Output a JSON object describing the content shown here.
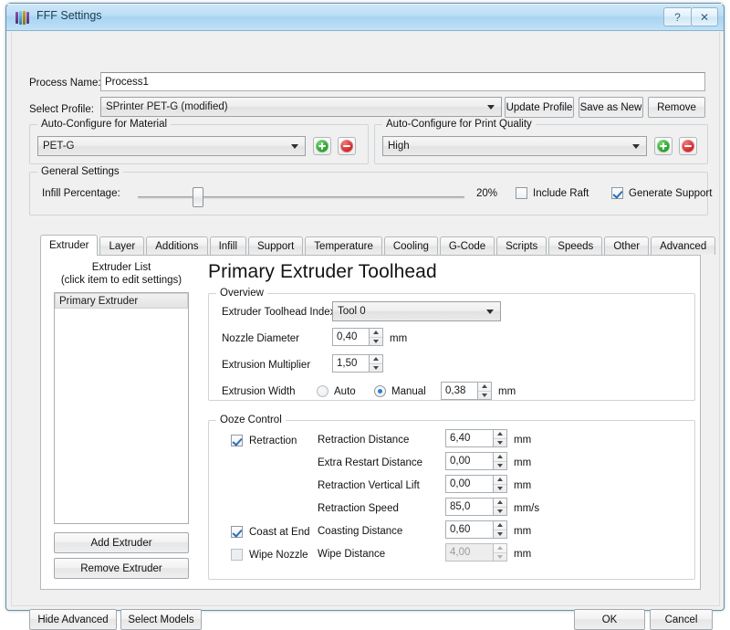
{
  "window": {
    "title": "FFF Settings",
    "icon": "extruder-bars-icon",
    "help_label": "?",
    "close_label": "✕"
  },
  "header": {
    "process_name_label": "Process Name:",
    "process_name_value": "Process1",
    "select_profile_label": "Select Profile:",
    "select_profile_value": "SPrinter PET-G (modified)",
    "update_profile_label": "Update Profile",
    "save_as_new_label": "Save as New",
    "remove_label": "Remove"
  },
  "material_group": {
    "title": "Auto-Configure for Material",
    "value": "PET-G",
    "add_label": "+",
    "remove_label": "−"
  },
  "quality_group": {
    "title": "Auto-Configure for Print Quality",
    "value": "High",
    "add_label": "+",
    "remove_label": "−"
  },
  "general_group": {
    "title": "General Settings",
    "infill_label": "Infill Percentage:",
    "infill_value": "20%",
    "infill_percent": 20,
    "include_raft_label": "Include Raft",
    "include_raft_checked": false,
    "generate_support_label": "Generate Support",
    "generate_support_checked": true
  },
  "tabs": [
    {
      "label": "Extruder",
      "active": true
    },
    {
      "label": "Layer",
      "active": false
    },
    {
      "label": "Additions",
      "active": false
    },
    {
      "label": "Infill",
      "active": false
    },
    {
      "label": "Support",
      "active": false
    },
    {
      "label": "Temperature",
      "active": false
    },
    {
      "label": "Cooling",
      "active": false
    },
    {
      "label": "G-Code",
      "active": false
    },
    {
      "label": "Scripts",
      "active": false
    },
    {
      "label": "Speeds",
      "active": false
    },
    {
      "label": "Other",
      "active": false
    },
    {
      "label": "Advanced",
      "active": false
    }
  ],
  "extruder_panel": {
    "list_title_line1": "Extruder List",
    "list_title_line2": "(click item to edit settings)",
    "items": [
      "Primary Extruder"
    ],
    "add_extruder_label": "Add Extruder",
    "remove_extruder_label": "Remove Extruder",
    "panel_title": "Primary Extruder Toolhead",
    "overview": {
      "title": "Overview",
      "toolhead_index_label": "Extruder Toolhead Index",
      "toolhead_index_value": "Tool 0",
      "nozzle_diameter_label": "Nozzle Diameter",
      "nozzle_diameter_value": "0,40",
      "nozzle_diameter_unit": "mm",
      "extrusion_multiplier_label": "Extrusion Multiplier",
      "extrusion_multiplier_value": "1,50",
      "extrusion_width_label": "Extrusion Width",
      "extrusion_width_auto_label": "Auto",
      "extrusion_width_manual_label": "Manual",
      "extrusion_width_mode": "Manual",
      "extrusion_width_value": "0,38",
      "extrusion_width_unit": "mm"
    },
    "ooze": {
      "title": "Ooze Control",
      "retraction_label": "Retraction",
      "retraction_checked": true,
      "coast_label": "Coast at End",
      "coast_checked": true,
      "wipe_label": "Wipe Nozzle",
      "wipe_checked": false,
      "rows": [
        {
          "label": "Retraction Distance",
          "value": "6,40",
          "unit": "mm",
          "disabled": false
        },
        {
          "label": "Extra Restart Distance",
          "value": "0,00",
          "unit": "mm",
          "disabled": false
        },
        {
          "label": "Retraction Vertical Lift",
          "value": "0,00",
          "unit": "mm",
          "disabled": false
        },
        {
          "label": "Retraction Speed",
          "value": "85,0",
          "unit": "mm/s",
          "disabled": false
        },
        {
          "label": "Coasting Distance",
          "value": "0,60",
          "unit": "mm",
          "disabled": false
        },
        {
          "label": "Wipe Distance",
          "value": "4,00",
          "unit": "mm",
          "disabled": true
        }
      ]
    }
  },
  "footer": {
    "hide_advanced_label": "Hide Advanced",
    "select_models_label": "Select Models",
    "ok_label": "OK",
    "cancel_label": "Cancel"
  },
  "colors": {
    "titlebar": "#b9dff8",
    "dialog_bg": "#f0f0f0",
    "panel_bg": "#ffffff",
    "accent_green": "#1f9a24",
    "accent_red": "#cc1f1f",
    "check_blue": "#2a6fb5"
  }
}
